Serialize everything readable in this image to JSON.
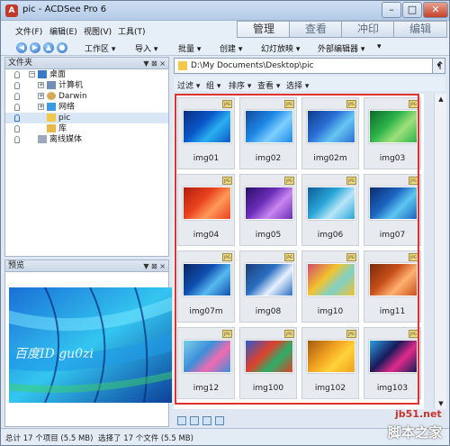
{
  "window": {
    "title": "pic - ACDSee Pro 6",
    "app_icon": "acdsee-app-icon",
    "min": "–",
    "max": "□",
    "close": "✕"
  },
  "menu": [
    {
      "label": "文件(F)"
    },
    {
      "label": "编辑(E)"
    },
    {
      "label": "视图(V)"
    },
    {
      "label": "工具(T)"
    }
  ],
  "mode_tabs": [
    {
      "label": "管理",
      "active": true
    },
    {
      "label": "查看",
      "active": false
    },
    {
      "label": "冲印",
      "active": false
    },
    {
      "label": "编辑",
      "active": false
    }
  ],
  "toolbar": {
    "items": [
      {
        "label": "工作区 ▾"
      },
      {
        "label": "导入 ▾"
      },
      {
        "label": "批量 ▾"
      },
      {
        "label": "创建 ▾"
      },
      {
        "label": "幻灯放映 ▾"
      },
      {
        "label": "外部编辑器 ▾"
      },
      {
        "label": "▾"
      }
    ]
  },
  "folders_panel": {
    "title": "文件夹",
    "controls": "▼ ⊠ ×",
    "tree": [
      {
        "label": "桌面",
        "expander": "−",
        "icon": "desktop-icon",
        "level": 0
      },
      {
        "label": "计算机",
        "expander": "+",
        "icon": "computer-icon",
        "level": 1
      },
      {
        "label": "Darwin",
        "expander": "+",
        "icon": "user-icon",
        "level": 1
      },
      {
        "label": "网络",
        "expander": "+",
        "icon": "network-icon",
        "level": 1
      },
      {
        "label": "pic",
        "expander": "",
        "icon": "folder-icon",
        "level": 1,
        "selected": true
      },
      {
        "label": "库",
        "expander": "",
        "icon": "library-icon",
        "level": 1
      },
      {
        "label": "离线媒体",
        "expander": "",
        "icon": "offline-media-icon",
        "level": 0
      }
    ]
  },
  "preview_panel": {
    "title": "预览",
    "controls": "▼ ⊠ ×",
    "watermark": "百度ID gu0zi"
  },
  "path": {
    "value": "D:\\My Documents\\Desktop\\pic"
  },
  "filter_bar": {
    "items": [
      {
        "label": "过滤 ▾"
      },
      {
        "label": "组 ▾"
      },
      {
        "label": "排序 ▾"
      },
      {
        "label": "查看 ▾"
      },
      {
        "label": "选择 ▾"
      }
    ]
  },
  "thumbnails": [
    {
      "label": "img01",
      "c1": "#0a57c8",
      "c2": "#2ab0f0",
      "c3": "#0b2f80"
    },
    {
      "label": "img02",
      "c1": "#1e88e5",
      "c2": "#7ed0ff",
      "c3": "#114a9c"
    },
    {
      "label": "img02m",
      "c1": "#2a6fd6",
      "c2": "#66c6f2",
      "c3": "#0d3c8a"
    },
    {
      "label": "img03",
      "c1": "#2db34a",
      "c2": "#9fe07a",
      "c3": "#0e6a2a"
    },
    {
      "label": "img04",
      "c1": "#e8421d",
      "c2": "#ff9a5a",
      "c3": "#b01e10"
    },
    {
      "label": "img05",
      "c1": "#6a2db6",
      "c2": "#c985f0",
      "c3": "#2a0f6a"
    },
    {
      "label": "img06",
      "c1": "#2aa5d8",
      "c2": "#b8e6f8",
      "c3": "#0e5c93"
    },
    {
      "label": "img07",
      "c1": "#1c63c0",
      "c2": "#5cc6f0",
      "c3": "#0b2c6e"
    },
    {
      "label": "img07m",
      "c1": "#0f4fb0",
      "c2": "#58b9ef",
      "c3": "#0a2460"
    },
    {
      "label": "img08",
      "c1": "#2b6ec0",
      "c2": "#e8f2ff",
      "c3": "#1b3f7a"
    },
    {
      "label": "img10",
      "c1": "#f2c32e",
      "c2": "#7fd0c8",
      "c3": "#d14a6a"
    },
    {
      "label": "img11",
      "c1": "#c8501a",
      "c2": "#ffb070",
      "c3": "#7a2a0a"
    },
    {
      "label": "img12",
      "c1": "#3c8fd8",
      "c2": "#f06ab0",
      "c3": "#7ad0e8"
    },
    {
      "label": "img100",
      "c1": "#e0402a",
      "c2": "#2ab068",
      "c3": "#2a5ad0"
    },
    {
      "label": "img102",
      "c1": "#f0a020",
      "c2": "#ffd23a",
      "c3": "#a05a10"
    },
    {
      "label": "img103",
      "c1": "#1a1a5a",
      "c2": "#e02a8a",
      "c3": "#2aa0e0"
    }
  ],
  "status": {
    "left": "总计 17 个项目 (5.5 MB)",
    "middle": "选择了 17 个文件 (5.5 MB)",
    "site": "jb51.net",
    "brand": "脚本之家"
  },
  "colors": {
    "selection_border": "#e03030",
    "accent": "#2a6fc2"
  }
}
